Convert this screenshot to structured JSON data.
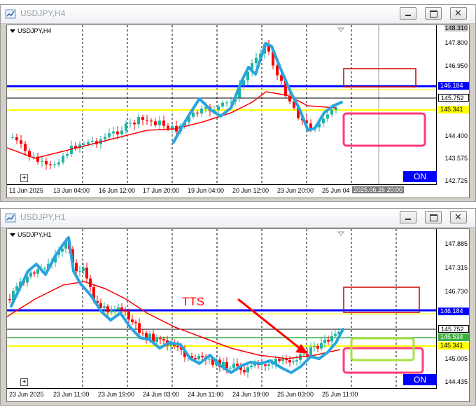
{
  "windows": [
    {
      "title": "USDJPY,H4",
      "symbol_label": "USDJPY,H4",
      "price_scale": [
        "148.310",
        "147.800",
        "146.950",
        "146.184",
        "145.752",
        "145.341",
        "144.400",
        "143.575",
        "142.725"
      ],
      "time_labels": [
        "11 Jun 2025",
        "13 Jun 04:00",
        "16 Jun 12:00",
        "17 Jun 20:00",
        "19 Jun 04:00",
        "20 Jun 12:00",
        "23 Jun 20:00",
        "25 Jun 04"
      ],
      "cursor_time": "2025.06.26 20:00",
      "on_label": "ON",
      "plus_label": "+",
      "tags": {
        "blue": "146.184",
        "white": "145.752",
        "yellow": "145.341"
      }
    },
    {
      "title": "USDJPY,H1",
      "symbol_label": "USDJPY,H1",
      "price_scale": [
        "147.885",
        "147.315",
        "146.730",
        "146.184",
        "145.752",
        "145.534",
        "145.341",
        "145.005",
        "144.435"
      ],
      "time_labels": [
        "23 Jun 2025",
        "23 Jun 11:00",
        "23 Jun 19:00",
        "24 Jun 03:00",
        "24 Jun 11:00",
        "24 Jun 19:00",
        "25 Jun 03:00",
        "25 Jun 11:00"
      ],
      "annotation": "TTS",
      "on_label": "ON",
      "plus_label": "+",
      "tags": {
        "blue": "146.184",
        "white": "145.752",
        "green": "145.534",
        "yellow": "145.341"
      }
    }
  ],
  "colors": {
    "bull": "#1fb3a2",
    "bear": "#ff0000",
    "ma": "#ff0000",
    "hand": "#28a4de",
    "resistance": "#0000ff",
    "yellow": "#ffff00",
    "green": "#3cb043",
    "box_red": "#cc0000",
    "box_pink": "#ff3b7a",
    "box_green": "#a8e040",
    "on_bg": "#0000ff"
  }
}
